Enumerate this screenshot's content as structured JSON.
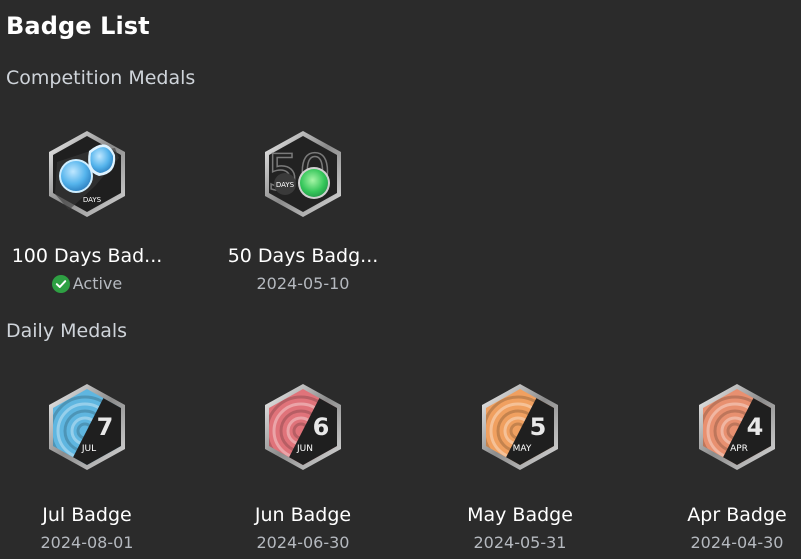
{
  "page_title": "Badge List",
  "sections": {
    "competition": {
      "title": "Competition Medals",
      "items": [
        {
          "name": "100 Days Bad...",
          "status": "Active",
          "badge_text": "DAYS",
          "accent": "#4aa3df"
        },
        {
          "name": "50 Days Badg...",
          "date": "2024-05-10",
          "badge_text": "DAYS",
          "badge_number": "50",
          "accent": "#3ecf6a"
        }
      ]
    },
    "daily": {
      "title": "Daily Medals",
      "items": [
        {
          "name": "Jul Badge",
          "date": "2024-08-01",
          "number": "7",
          "month": "JUL",
          "accent": "#5fb6e0"
        },
        {
          "name": "Jun Badge",
          "date": "2024-06-30",
          "number": "6",
          "month": "JUN",
          "accent": "#e0737a"
        },
        {
          "name": "May Badge",
          "date": "2024-05-31",
          "number": "5",
          "month": "MAY",
          "accent": "#f0a060"
        },
        {
          "name": "Apr Badge",
          "date": "2024-04-30",
          "number": "4",
          "month": "APR",
          "accent": "#e89070"
        }
      ]
    }
  },
  "colors": {
    "background": "#2b2b2b",
    "active_green": "#2ea043",
    "subtext": "#b5b9bf"
  }
}
